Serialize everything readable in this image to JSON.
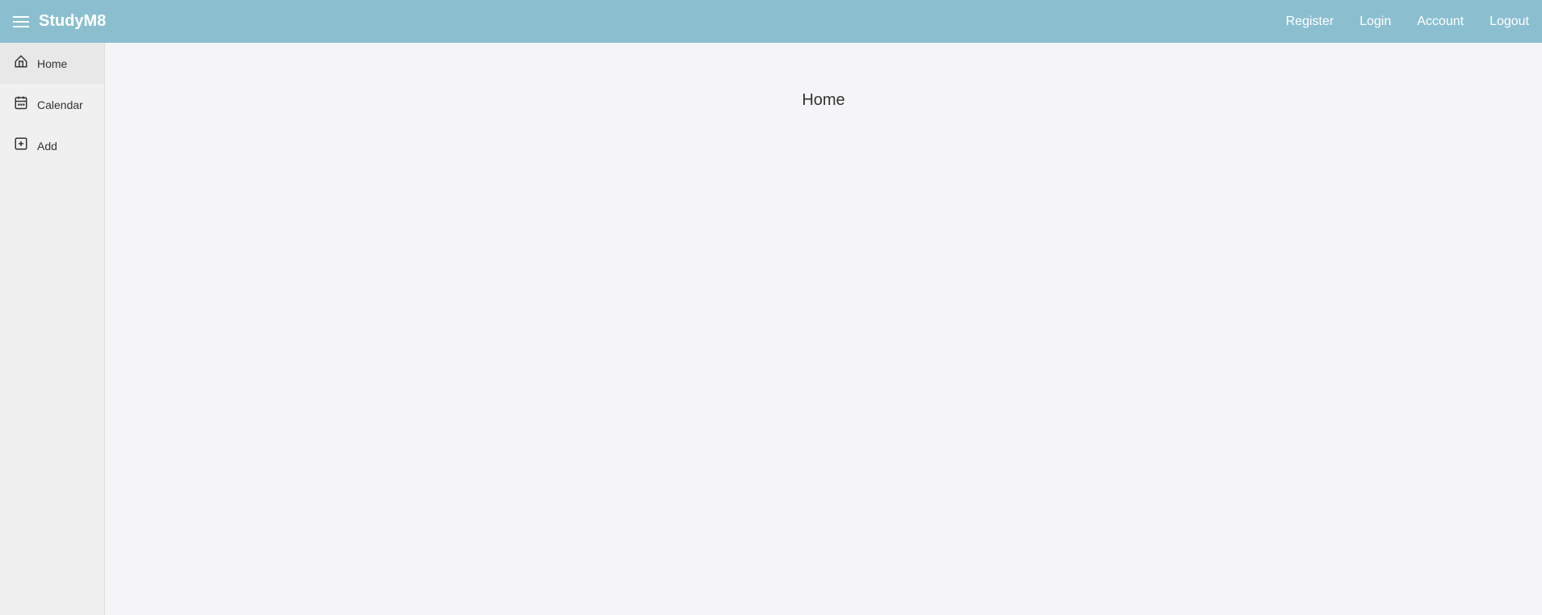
{
  "navbar": {
    "brand": "StudyM8",
    "links": {
      "register": "Register",
      "login": "Login",
      "account": "Account",
      "logout": "Logout"
    },
    "menu_icon": "menu-icon"
  },
  "sidebar": {
    "items": [
      {
        "id": "home",
        "label": "Home",
        "icon": "home-icon",
        "active": true
      },
      {
        "id": "calendar",
        "label": "Calendar",
        "icon": "calendar-icon",
        "active": false
      },
      {
        "id": "add",
        "label": "Add",
        "icon": "add-icon",
        "active": false
      }
    ]
  },
  "content": {
    "title": "Home"
  }
}
